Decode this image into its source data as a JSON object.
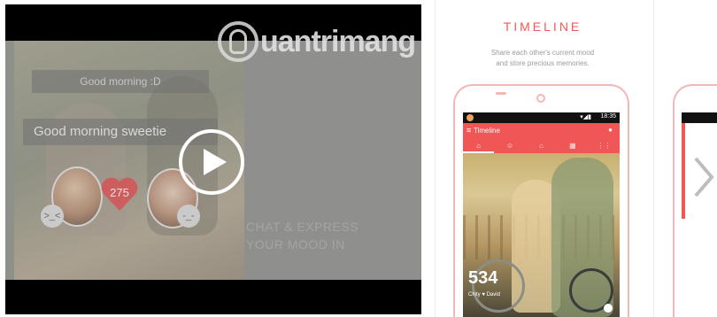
{
  "video": {
    "greeting_small": "Good morning :D",
    "greeting_main": "Good morning sweetie",
    "heart_count": "275",
    "emoji_left": ">_<",
    "emoji_right": "-_-",
    "caption_lines": [
      "CHAT & EXPRESS",
      "YOUR MOOD IN"
    ],
    "watermark": "uantrimang",
    "play_icon": "play-icon"
  },
  "timeline": {
    "title": "TIMELINE",
    "subtitle_lines": [
      "Share each other's current mood",
      "and store precious memories."
    ],
    "status_time": "18:35",
    "status_signal": "▾◢▮",
    "app_title": "Timeline",
    "tabs": [
      "⌂",
      "☺",
      "⌂",
      "▦",
      "⋮⋮"
    ],
    "counter": "534",
    "names": "Chity ♥ David"
  },
  "navigation": {
    "next_icon": "chevron-right-icon"
  },
  "colors": {
    "accent": "#f05656",
    "phone_outline": "#f5b6b6",
    "title_color": "#f05a5a"
  }
}
